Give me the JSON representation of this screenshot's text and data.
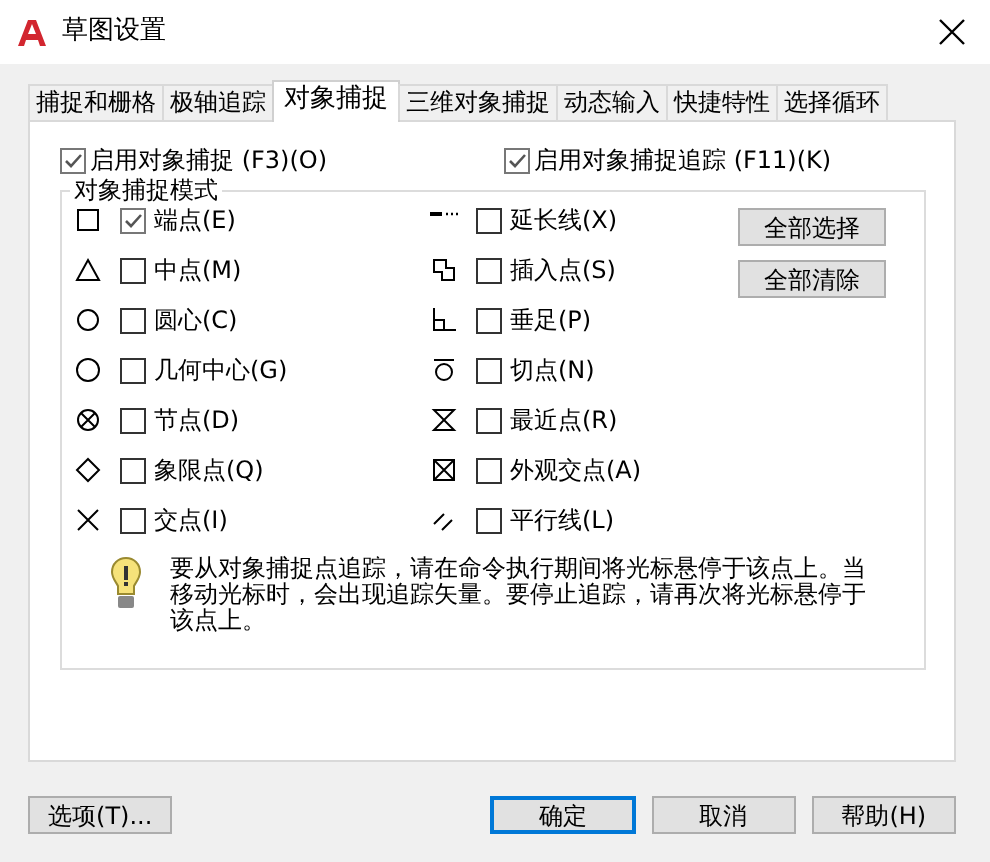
{
  "window": {
    "title": "草图设置"
  },
  "tabs": [
    {
      "label": "捕捉和栅格",
      "selected": false
    },
    {
      "label": "极轴追踪",
      "selected": false
    },
    {
      "label": "对象捕捉",
      "selected": true
    },
    {
      "label": "三维对象捕捉",
      "selected": false
    },
    {
      "label": "动态输入",
      "selected": false
    },
    {
      "label": "快捷特性",
      "selected": false
    },
    {
      "label": "选择循环",
      "selected": false
    }
  ],
  "top_options": [
    {
      "label": "启用对象捕捉 (F3)(O)",
      "checked": true
    },
    {
      "label": "启用对象捕捉追踪 (F11)(K)",
      "checked": true
    }
  ],
  "snap_modes": {
    "title": "对象捕捉模式",
    "columns": [
      [
        {
          "kind": "endpoint",
          "label": "端点(E)",
          "checked": true
        },
        {
          "kind": "midpoint",
          "label": "中点(M)",
          "checked": false
        },
        {
          "kind": "center",
          "label": "圆心(C)",
          "checked": false
        },
        {
          "kind": "geocenter",
          "label": "几何中心(G)",
          "checked": false
        },
        {
          "kind": "node",
          "label": "节点(D)",
          "checked": false
        },
        {
          "kind": "quadrant",
          "label": "象限点(Q)",
          "checked": false
        },
        {
          "kind": "intersection",
          "label": "交点(I)",
          "checked": false
        }
      ],
      [
        {
          "kind": "extension",
          "label": "延长线(X)",
          "checked": false
        },
        {
          "kind": "insertion",
          "label": "插入点(S)",
          "checked": false
        },
        {
          "kind": "perpendicular",
          "label": "垂足(P)",
          "checked": false
        },
        {
          "kind": "tangent",
          "label": "切点(N)",
          "checked": false
        },
        {
          "kind": "nearest",
          "label": "最近点(R)",
          "checked": false
        },
        {
          "kind": "apparent",
          "label": "外观交点(A)",
          "checked": false
        },
        {
          "kind": "parallel",
          "label": "平行线(L)",
          "checked": false
        }
      ]
    ],
    "buttons": [
      "全部选择",
      "全部清除"
    ]
  },
  "hint": "要从对象捕捉点追踪，请在命令执行期间将光标悬停于该点上。当移动光标时，会出现追踪矢量。要停止追踪，请再次将光标悬停于该点上。",
  "buttons": [
    {
      "label": "选项(T)...",
      "default": false
    },
    {
      "label": "确定",
      "default": true
    },
    {
      "label": "取消",
      "default": false
    },
    {
      "label": "帮助(H)",
      "default": false
    }
  ]
}
